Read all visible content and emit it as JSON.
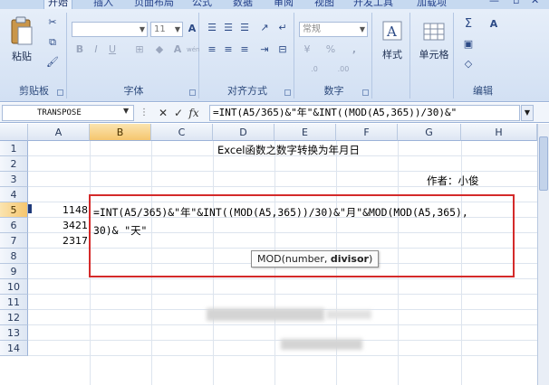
{
  "ribbon": {
    "tabs": [
      "开始",
      "插入",
      "页面布局",
      "公式",
      "数据",
      "审阅",
      "视图",
      "开发工具",
      "加载项"
    ],
    "active_tab": "开始",
    "groups": {
      "clipboard": {
        "label": "剪贴板",
        "paste_label": "粘贴"
      },
      "font": {
        "label": "字体",
        "font_size": "11",
        "grow": "A",
        "shrink": "A",
        "bold": "B",
        "italic": "I",
        "underline": "U",
        "wen": "wén"
      },
      "alignment": {
        "label": "对齐方式"
      },
      "number": {
        "label": "数字",
        "format": "常规",
        "percent": "%",
        "comma": ",",
        "inc_decimal": ".0",
        "dec_decimal": ".00"
      },
      "styles": {
        "label": "样式"
      },
      "cells": {
        "label": "单元格"
      },
      "editing": {
        "label": "编辑",
        "sum": "Σ",
        "sort": "A"
      }
    }
  },
  "formula_bar": {
    "name_box": "TRANSPOSE",
    "cancel": "✕",
    "enter": "✓",
    "fx": "fx",
    "formula": "=INT(A5/365)&\"年\"&INT((MOD(A5,365))/30)&\""
  },
  "grid": {
    "columns": [
      "A",
      "B",
      "C",
      "D",
      "E",
      "F",
      "G",
      "H"
    ],
    "active_column": "B",
    "rows": [
      "1",
      "2",
      "3",
      "4",
      "5",
      "6",
      "7",
      "8",
      "9",
      "10",
      "11",
      "12",
      "13",
      "14"
    ],
    "active_row": "5",
    "cells": {
      "title": "Excel函数之数字转换为年月日",
      "author": "作者：小俊",
      "a5": "1148",
      "a6": "3421",
      "a7": "2317"
    },
    "edit_line1": "=INT(A5/365)&\"年\"&INT((MOD(A5,365))/30)&\"月\"&MOD(MOD(A5,365),",
    "edit_line2": "30)& \"天\"",
    "tooltip_fn": "MOD(number, ",
    "tooltip_arg": "divisor",
    "tooltip_end": ")"
  },
  "colors": {
    "highlight_box": "#d42a2a",
    "header_selected": "#f5c66e",
    "ribbon": "#d2e0f3"
  }
}
